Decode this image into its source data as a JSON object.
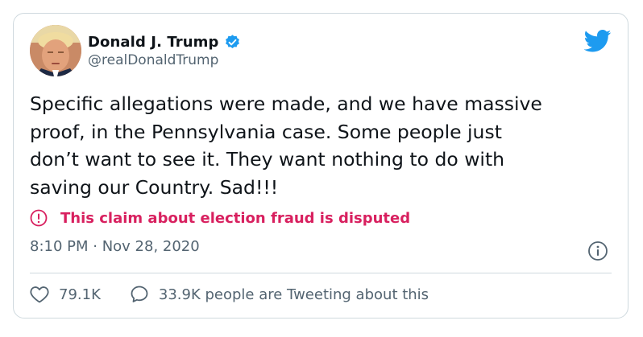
{
  "author": {
    "display_name": "Donald J. Trump",
    "handle": "@realDonaldTrump",
    "verified": true,
    "avatar_icon": "profile-photo"
  },
  "tweet": {
    "text": "Specific allegations were made, and we have massive\nproof, in the Pennsylvania case. Some people just\ndon’t want to see it. They want nothing to do with\nsaving our Country. Sad!!!",
    "dispute_notice": "This claim about election fraud is disputed",
    "timestamp": "8:10 PM · Nov 28, 2020"
  },
  "engagement": {
    "likes": "79.1K",
    "conversation": "33.9K people are Tweeting about this"
  },
  "icons": {
    "brand": "twitter-bird-icon",
    "verified": "verified-badge-icon",
    "dispute": "exclamation-circle-icon",
    "info": "info-icon",
    "like": "heart-icon",
    "reply": "speech-bubble-icon"
  },
  "colors": {
    "brand_blue": "#1d9bf0",
    "dispute_red": "#d8205f",
    "text_primary": "#0f1419",
    "text_secondary": "#536471",
    "border": "#cfd9de"
  }
}
